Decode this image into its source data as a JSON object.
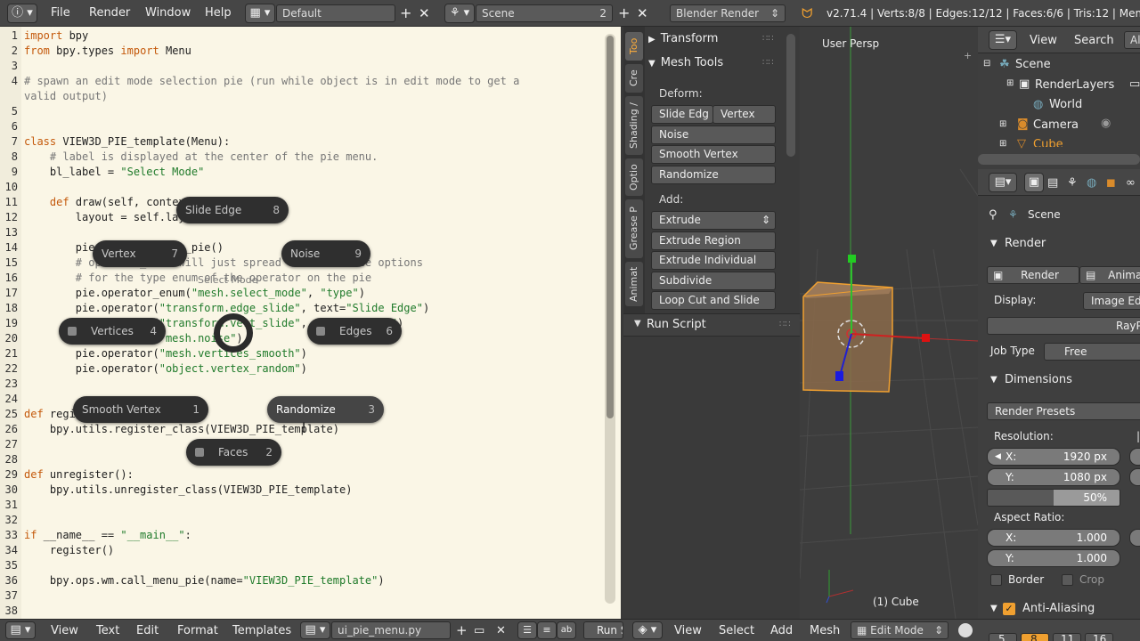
{
  "topbar": {
    "menus": [
      "File",
      "Render",
      "Window",
      "Help"
    ],
    "layout": "Default",
    "scene": "Scene",
    "scene_count": "2",
    "engine": "Blender Render",
    "stats": "v2.71.4 | Verts:8/8 | Edges:12/12 | Faces:6/6 | Tris:12 | Mem:"
  },
  "editor": {
    "lines": [
      {
        "n": "1",
        "t": "import bpy"
      },
      {
        "n": "2",
        "t": "from bpy.types import Menu"
      },
      {
        "n": "3",
        "t": ""
      },
      {
        "n": "4",
        "t": "# spawn an edit mode selection pie (run while object is in edit mode to get a"
      },
      {
        "n": "",
        "t": "valid output)"
      },
      {
        "n": "5",
        "t": ""
      },
      {
        "n": "6",
        "t": ""
      },
      {
        "n": "7",
        "t": "class VIEW3D_PIE_template(Menu):"
      },
      {
        "n": "8",
        "t": "    # label is displayed at the center of the pie menu."
      },
      {
        "n": "9",
        "t": "    bl_label = \"Select Mode\""
      },
      {
        "n": "10",
        "t": ""
      },
      {
        "n": "11",
        "t": "    def draw(self, context):"
      },
      {
        "n": "12",
        "t": "        layout = self.layout"
      },
      {
        "n": "13",
        "t": ""
      },
      {
        "n": "14",
        "t": "        pie = layout.menu_pie()"
      },
      {
        "n": "15",
        "t": "        # operator_enum will just spread all available options"
      },
      {
        "n": "16",
        "t": "        # for the type enum of the operator on the pie"
      },
      {
        "n": "17",
        "t": "        pie.operator_enum(\"mesh.select_mode\", \"type\")"
      },
      {
        "n": "18",
        "t": "        pie.operator(\"transform.edge_slide\", text=\"Slide Edge\")"
      },
      {
        "n": "19",
        "t": "        pie.operator(\"transform.vert_slide\", text=\"Vertex\")"
      },
      {
        "n": "20",
        "t": "        pie.operator(\"mesh.noise\")"
      },
      {
        "n": "21",
        "t": "        pie.operator(\"mesh.vertices_smooth\")"
      },
      {
        "n": "22",
        "t": "        pie.operator(\"object.vertex_random\")"
      },
      {
        "n": "23",
        "t": ""
      },
      {
        "n": "24",
        "t": ""
      },
      {
        "n": "25",
        "t": "def register():"
      },
      {
        "n": "26",
        "t": "    bpy.utils.register_class(VIEW3D_PIE_template)"
      },
      {
        "n": "27",
        "t": ""
      },
      {
        "n": "28",
        "t": ""
      },
      {
        "n": "29",
        "t": "def unregister():"
      },
      {
        "n": "30",
        "t": "    bpy.utils.unregister_class(VIEW3D_PIE_template)"
      },
      {
        "n": "31",
        "t": ""
      },
      {
        "n": "32",
        "t": ""
      },
      {
        "n": "33",
        "t": "if __name__ == \"__main__\":"
      },
      {
        "n": "34",
        "t": "    register()"
      },
      {
        "n": "35",
        "t": ""
      },
      {
        "n": "36",
        "t": "    bpy.ops.wm.call_menu_pie(name=\"VIEW3D_PIE_template\")"
      },
      {
        "n": "37",
        "t": ""
      },
      {
        "n": "38",
        "t": ""
      }
    ]
  },
  "pie": {
    "title": "Select Mode",
    "items": [
      {
        "label": "Slide Edge",
        "key": "8"
      },
      {
        "label": "Vertex",
        "key": "7"
      },
      {
        "label": "Noise",
        "key": "9"
      },
      {
        "label": "Vertices",
        "key": "4"
      },
      {
        "label": "Edges",
        "key": "6"
      },
      {
        "label": "Smooth Vertex",
        "key": "1"
      },
      {
        "label": "Randomize",
        "key": "3"
      },
      {
        "label": "Faces",
        "key": "2"
      }
    ]
  },
  "editor_bar": {
    "menus": [
      "View",
      "Text",
      "Edit",
      "Format",
      "Templates"
    ],
    "filename": "ui_pie_menu.py",
    "run": "Run S"
  },
  "toolshelf": {
    "tabs": [
      "Too",
      "Cre",
      "Shading /",
      "Optio",
      "Grease P",
      "Animat"
    ],
    "transform": "Transform",
    "mesh_tools": "Mesh Tools",
    "deform": "Deform:",
    "slide_edge": "Slide Edg",
    "vertex": "Vertex",
    "noise": "Noise",
    "smooth_vertex": "Smooth Vertex",
    "randomize": "Randomize",
    "add": "Add:",
    "extrude": "Extrude",
    "extrude_region": "Extrude Region",
    "extrude_individual": "Extrude Individual",
    "subdivide": "Subdivide",
    "loop_cut": "Loop Cut and Slide",
    "run_script": "Run Script"
  },
  "viewport": {
    "persp": "User Persp",
    "object": "(1) Cube",
    "menus": [
      "View",
      "Select",
      "Add",
      "Mesh"
    ],
    "mode": "Edit Mode"
  },
  "outliner": {
    "view": "View",
    "search": "Search",
    "all": "Al",
    "items": [
      "Scene",
      "RenderLayers",
      "World",
      "Camera",
      "Cube"
    ]
  },
  "properties": {
    "scene": "Scene",
    "render": "Render",
    "render_btn": "Render",
    "anim_btn": "Animat",
    "display": "Display:",
    "display_val": "Image Edi",
    "raypump": "RayPum",
    "job_type": "Job Type",
    "job_val": "Free",
    "dimensions": "Dimensions",
    "presets": "Render Presets",
    "resolution": "Resolution:",
    "res_x_label": "X:",
    "res_x": "1920 px",
    "res_y_label": "Y:",
    "res_y": "1080 px",
    "res_pct": "50%",
    "aspect": "Aspect Ratio:",
    "asp_x_label": "X:",
    "asp_x": "1.000",
    "asp_y_label": "Y:",
    "asp_y": "1.000",
    "border": "Border",
    "crop": "Crop",
    "anti_aliasing": "Anti-Aliasing",
    "aa_samples": [
      "5",
      "8",
      "11",
      "16"
    ]
  },
  "colors": {
    "accent": "#f0a030",
    "editor_bg": "#faf6e6"
  }
}
